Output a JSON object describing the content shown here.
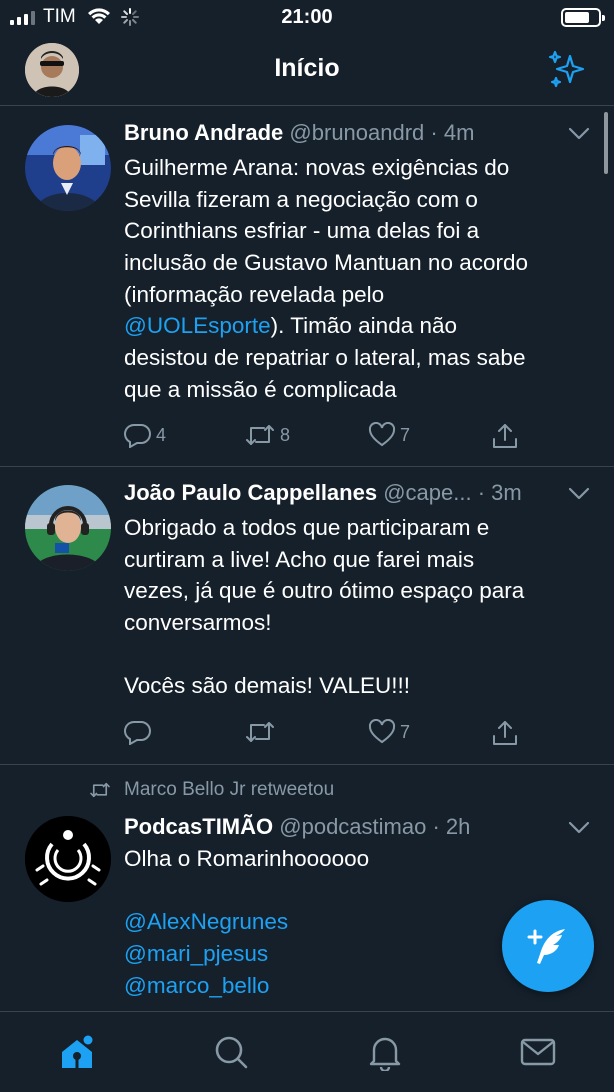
{
  "status_bar": {
    "carrier": "TIM",
    "time": "21:00"
  },
  "header": {
    "title": "Início"
  },
  "tweets": [
    {
      "name": "Bruno Andrade",
      "handle": "@brunoandrd",
      "time": "4m",
      "text_lines": [
        "Guilherme Arana: novas exigências do",
        "Sevilla fizeram a negociação com o",
        "Corinthians esfriar - uma delas foi a",
        "inclusão de Gustavo Mantuan no acordo",
        "(informação revelada pelo"
      ],
      "mention": "@UOLEsporte",
      "text_after_mention": "). Timão ainda não",
      "text_lines_end": [
        "desistou de repatriar o lateral, mas sabe",
        "que a missão é complicada"
      ],
      "replies": "4",
      "retweets": "8",
      "likes": "7"
    },
    {
      "name": "João Paulo Cappellanes",
      "handle": "@cape...",
      "time": "3m",
      "text_lines": [
        "Obrigado a todos que participaram e",
        "curtiram a live! Acho que farei mais",
        "vezes, já que é outro ótimo espaço para",
        "conversarmos!",
        "",
        "Vocês são demais! VALEU!!!"
      ],
      "replies": "",
      "retweets": "",
      "likes": "7"
    },
    {
      "retweeted_by": "Marco Bello Jr retweetou",
      "name": "PodcasTIMÃO",
      "handle": "@podcastimao",
      "time": "2h",
      "text_lines": [
        "Olha o Romarinhoooooo"
      ],
      "mentions": [
        "@AlexNegrunes",
        "@mari_pjesus",
        "@marco_bello"
      ]
    }
  ],
  "colors": {
    "background": "#15202b",
    "accent": "#1da1f2",
    "secondary_text": "#8899a6",
    "divider": "#38444d"
  },
  "icons": [
    "signal-icon",
    "wifi-icon",
    "loading-icon",
    "battery-icon",
    "sparkle-icon",
    "chevron-down-icon",
    "reply-icon",
    "retweet-icon",
    "like-icon",
    "share-icon",
    "compose-icon",
    "home-icon",
    "search-icon",
    "notifications-icon",
    "messages-icon"
  ]
}
